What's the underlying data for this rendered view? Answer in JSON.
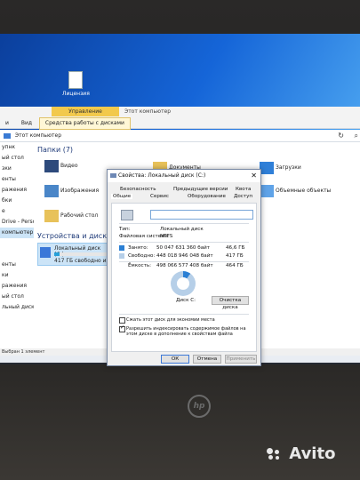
{
  "desktop": {
    "file_label": "Лицензия"
  },
  "ribbon": {
    "manage_label": "Управление",
    "computer_label": "Этот компьютер",
    "tabs": [
      "и",
      "Вид",
      "Средства работы с дисками"
    ]
  },
  "address": {
    "path": "Этот компьютер",
    "refresh_icon": "refresh-icon",
    "search_icon": "search-icon"
  },
  "nav": {
    "items": [
      "упнк",
      "ый стол",
      "зки",
      "енты",
      "ражения",
      "бки",
      "е",
      "Drive - Personal",
      "компьютер",
      "",
      "",
      "енты",
      "ки",
      "ражения",
      "ый стол",
      "льный диск (C:)",
      ""
    ]
  },
  "content": {
    "folders_header": "Папки (7)",
    "folders": [
      "Видео",
      "Изображения",
      "Рабочий стол",
      "Документы",
      "Загрузки",
      "Объемные объекты"
    ],
    "devices_header": "Устройства и диски (2)",
    "drive_name": "Локальный диск (C:)",
    "drive_free": "417 ГБ свободно из"
  },
  "statusbar": {
    "text": "Выбран 1 элемент"
  },
  "dialog": {
    "title": "Свойства: Локальный диск (C:)",
    "tabs_row1": [
      "Безопасность",
      "Предыдущие версии",
      "Квота"
    ],
    "tabs_row2": [
      "Общие",
      "Сервис",
      "Оборудование",
      "Доступ"
    ],
    "type_label": "Тип:",
    "type_value": "Локальный диск",
    "fs_label": "Файловая система:",
    "fs_value": "NTFS",
    "used_label": "Занято:",
    "used_bytes": "50 047 631 360 байт",
    "used_gb": "46,6 ГБ",
    "free_label": "Свободно:",
    "free_bytes": "448 018 946 048 байт",
    "free_gb": "417 ГБ",
    "cap_label": "Ёмкость:",
    "cap_bytes": "498 066 577 408 байт",
    "cap_gb": "464 ГБ",
    "disk_label": "Диск C:",
    "cleanup_button": "Очистка диска",
    "compress_label": "Сжать этот диск для экономии места",
    "index_label": "Разрешить индексировать содержимое файлов на этом диске в дополнение к свойствам файла",
    "ok_button": "ОК",
    "cancel_button": "Отмена",
    "apply_button": "Применить",
    "used_fraction": 0.1
  },
  "colors": {
    "used": "#2a7fd4",
    "free": "#b6cfe8",
    "accent": "#3b78d8"
  },
  "brand": {
    "hp": "hp",
    "avito": "Avito"
  }
}
